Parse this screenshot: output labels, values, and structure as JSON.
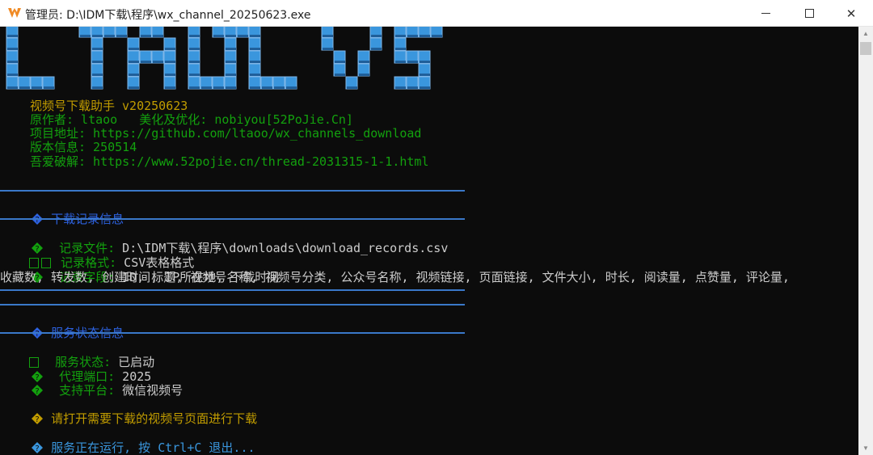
{
  "window": {
    "title": "管理员: D:\\IDM下载\\程序\\wx_channel_20250623.exe",
    "minimize": "minimize",
    "maximize": "maximize",
    "close": "close",
    "close_glyph": "✕"
  },
  "banner": {
    "text": "LTAOO VS",
    "colors": {
      "fill": "#3a96dd",
      "shade": "#1f5f9a",
      "outline": "#7fb6e8"
    }
  },
  "info": {
    "title": "视频号下载助手 v20250623",
    "author": "原作者: ltaoo   美化及优化: nobiyou[52PoJie.Cn]",
    "project": "项目地址: https://github.com/ltaoo/wx_channels_download",
    "version": "版本信息: 250514",
    "forum": "吾爱破解: https://www.52pojie.cn/thread-2031315-1-1.html"
  },
  "records_section": {
    "heading": "下载记录信息",
    "file_label": "记录文件:",
    "file_value": " D:\\IDM下载\\程序\\downloads\\download_records.csv",
    "format_label": "记录格式:",
    "format_value": " CSV表格格式",
    "fields_label": "记录字段:",
    "fields_value_1": " ID, 标题, 视频号名称, 视频号分类, 公众号名称, 视频链接, 页面链接, 文件大小, 时长, 阅读量, 点赞量, 评论量,",
    "fields_value_2": "收藏数, 转发数, 创建时间, IP所在地, 下载时间"
  },
  "service_section": {
    "heading": "服务状态信息",
    "status_label": "服务状态:",
    "status_value": " 已启动",
    "port_label": "代理端口:",
    "port_value": " 2025",
    "platform_label": "支持平台:",
    "platform_value": " 微信视频号"
  },
  "prompt": "请打开需要下载的视频号页面进行下载",
  "running": "服务正在运行, 按 Ctrl+C 退出...",
  "colors": {
    "console_bg": "#0c0c0c",
    "yellow": "#c19c00",
    "green": "#13a10e",
    "white": "#cccccc",
    "blue": "#2d62e0",
    "cyan": "#3a96dd",
    "rule": "#3a78c9"
  }
}
